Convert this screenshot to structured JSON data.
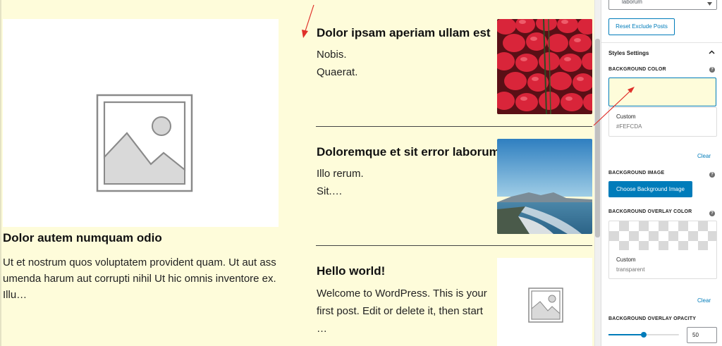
{
  "featured": {
    "title": "Dolor autem numquam odio",
    "excerpt": "Ut et nostrum quos voluptatem provident quam. Ut aut assumenda harum aut corrupti nihil Ut hic omnis inventore ex. Illu…"
  },
  "posts": [
    {
      "title": "Dolor ipsam aperiam ullam est",
      "line1": "Nobis.",
      "line2": "Quaerat.",
      "thumb_icon": "strawberries-image"
    },
    {
      "title": "Doloremque et sit error laborum",
      "line1": "Illo rerum.",
      "line2": "Sit.…",
      "thumb_icon": "beach-image"
    },
    {
      "title": "Hello world!",
      "excerpt": "Welcome to WordPress. This is your first post. Edit or delete it, then start …",
      "thumb_icon": "image-placeholder-icon"
    }
  ],
  "panel": {
    "select_value": "laborum",
    "reset_button": "Reset Exclude Posts",
    "styles_section": "Styles Settings",
    "background_color": {
      "label": "BACKGROUND COLOR",
      "swatch": "#fefcda",
      "custom_label": "Custom",
      "custom_value": "#FEFCDA",
      "clear": "Clear"
    },
    "background_image": {
      "label": "BACKGROUND IMAGE",
      "button": "Choose Background Image"
    },
    "overlay_color": {
      "label": "BACKGROUND OVERLAY COLOR",
      "custom_label": "Custom",
      "custom_value": "transparent",
      "clear": "Clear"
    },
    "overlay_opacity": {
      "label": "BACKGROUND OVERLAY OPACITY",
      "value": "50",
      "fraction": 0.5
    }
  },
  "colors": {
    "accent": "#007cba",
    "preview_bg": "#fefcda",
    "annotation": "#e0302a"
  }
}
